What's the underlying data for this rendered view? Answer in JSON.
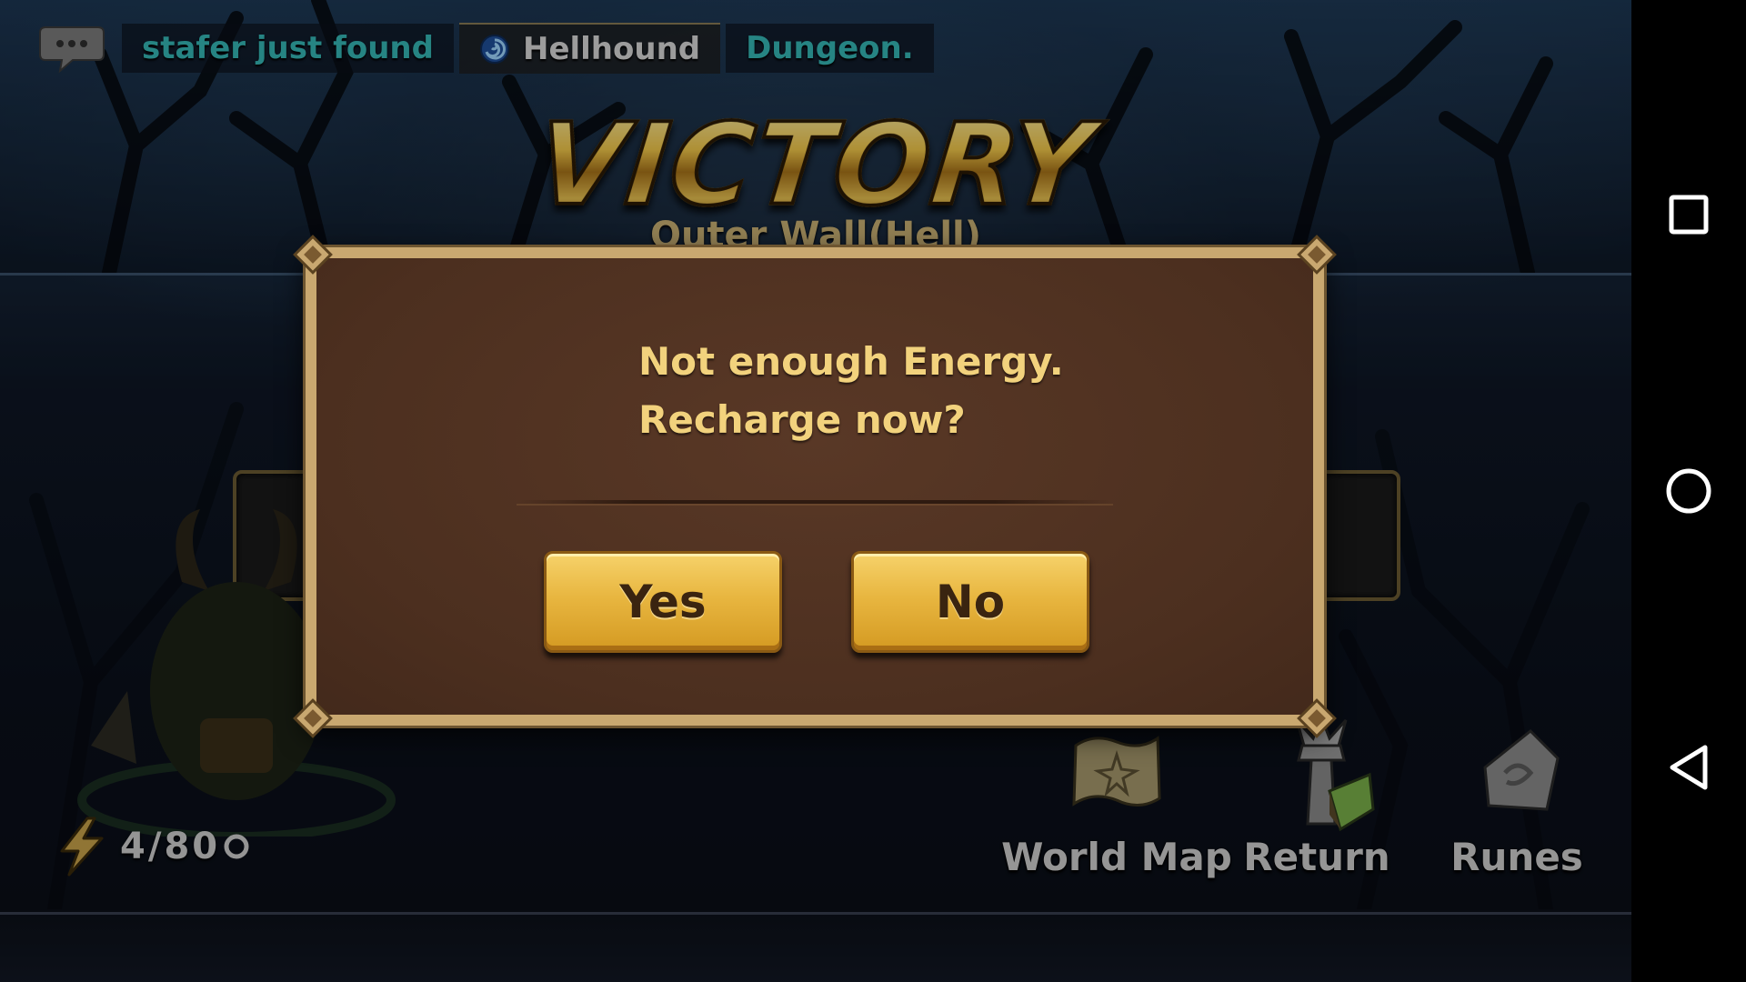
{
  "chat": {
    "player_text": "stafer just found",
    "monster_name": "Hellhound",
    "location_text": "Dungeon."
  },
  "victory": {
    "title": "VICTORY",
    "stage_name": "Outer Wall(Hell)"
  },
  "energy": {
    "value": "4/80"
  },
  "bottom_nav": {
    "world_map_label": "World Map",
    "return_label": "Return",
    "runes_label": "Runes"
  },
  "dialog": {
    "message_line1": "Not enough Energy.",
    "message_line2": "Recharge now?",
    "yes_label": "Yes",
    "no_label": "No"
  },
  "android_nav": {
    "icons": [
      "recents-icon",
      "home-icon",
      "back-icon"
    ]
  },
  "colors": {
    "dialog_bg": "#4f3120",
    "dialog_border": "#c9a870",
    "message_text": "#f2d27d",
    "button_gold": "#e8b640",
    "chat_teal": "#35b7b6",
    "victory_gold": "#d6a62a"
  }
}
